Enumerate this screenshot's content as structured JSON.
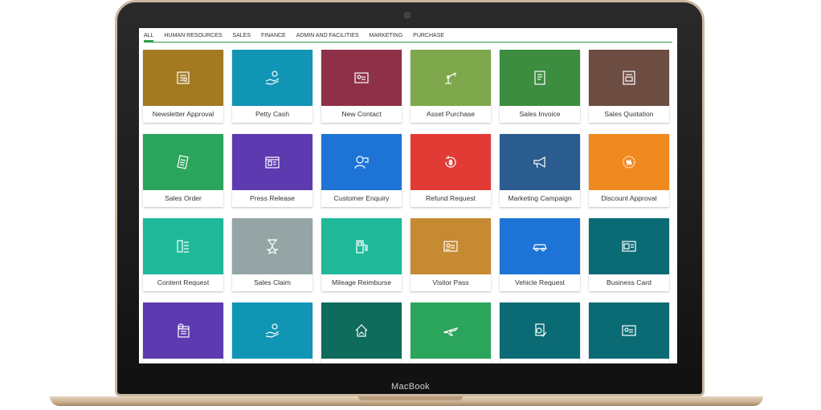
{
  "device": {
    "brand": "MacBook"
  },
  "tabs": [
    {
      "label": "ALL",
      "active": true
    },
    {
      "label": "HUMAN RESOURCES"
    },
    {
      "label": "SALES"
    },
    {
      "label": "FINANCE"
    },
    {
      "label": "ADMIN AND FACILITIES"
    },
    {
      "label": "MARKETING"
    },
    {
      "label": "PURCHASE"
    }
  ],
  "tiles": [
    {
      "label": "Newsletter Approval",
      "color": "#a37a22",
      "icon": "newsletter-icon"
    },
    {
      "label": "Petty Cash",
      "color": "#1195b4",
      "icon": "hand-coin-icon"
    },
    {
      "label": "New Contact",
      "color": "#8e3048",
      "icon": "contact-card-icon"
    },
    {
      "label": "Asset Purchase",
      "color": "#7ea84b",
      "icon": "robot-arm-icon"
    },
    {
      "label": "Sales Invoice",
      "color": "#3c8d3f",
      "icon": "invoice-icon"
    },
    {
      "label": "Sales Quotation",
      "color": "#6d4c41",
      "icon": "quotation-icon"
    },
    {
      "label": "Sales Order",
      "color": "#2ba55b",
      "icon": "order-receipt-icon"
    },
    {
      "label": "Press Release",
      "color": "#5e3ab0",
      "icon": "press-icon"
    },
    {
      "label": "Customer Enquiry",
      "color": "#1e74d6",
      "icon": "customer-icon"
    },
    {
      "label": "Refund Request",
      "color": "#e23b36",
      "icon": "refund-icon"
    },
    {
      "label": "Marketing Campaign",
      "color": "#2b5c8f",
      "icon": "megaphone-icon"
    },
    {
      "label": "Discount Approval",
      "color": "#f0891f",
      "icon": "discount-badge-icon"
    },
    {
      "label": "Content Request",
      "color": "#1fb99a",
      "icon": "content-list-icon"
    },
    {
      "label": "Sales Claim",
      "color": "#95a5a6",
      "icon": "hourglass-star-icon"
    },
    {
      "label": "Mileage Reimburse",
      "color": "#1fb99a",
      "icon": "fuel-pump-icon"
    },
    {
      "label": "Visitor Pass",
      "color": "#c68a33",
      "icon": "visitor-card-icon"
    },
    {
      "label": "Vehicle Request",
      "color": "#1e74d6",
      "icon": "car-icon"
    },
    {
      "label": "Business Card",
      "color": "#0b6b74",
      "icon": "business-card-icon"
    },
    {
      "label": "",
      "color": "#5e3ab0",
      "icon": "calendar-clock-icon"
    },
    {
      "label": "",
      "color": "#1195b4",
      "icon": "hand-coin-icon"
    },
    {
      "label": "",
      "color": "#0f6b5c",
      "icon": "home-hand-icon"
    },
    {
      "label": "",
      "color": "#2ba55b",
      "icon": "airplane-icon"
    },
    {
      "label": "",
      "color": "#0b6b74",
      "icon": "document-check-icon"
    },
    {
      "label": "",
      "color": "#0b6b74",
      "icon": "id-card-icon"
    }
  ]
}
